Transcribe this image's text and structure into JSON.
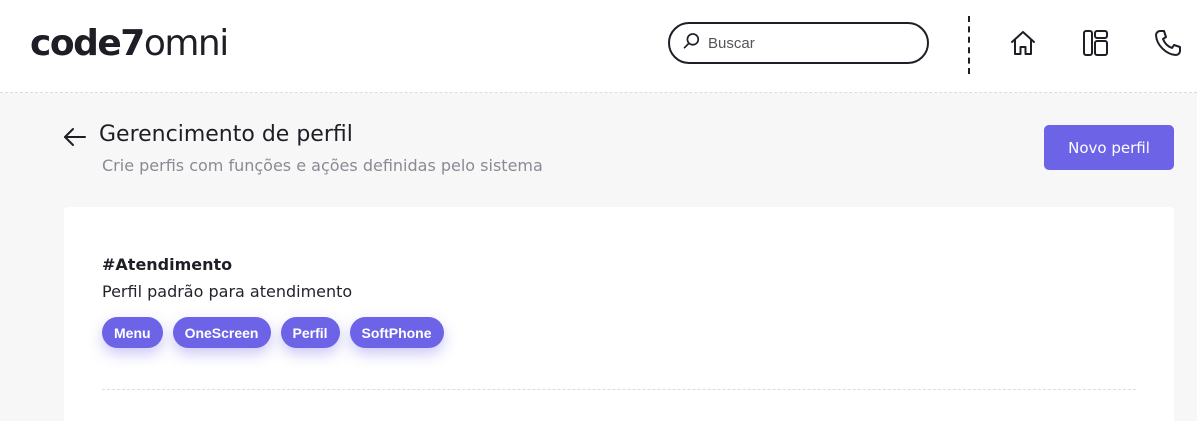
{
  "header": {
    "logo_bold": "code7",
    "logo_light": "omni",
    "search_placeholder": "Buscar"
  },
  "page": {
    "title": "Gerencimento de perfil",
    "subtitle": "Crie perfis com funções e ações definidas pelo sistema",
    "new_button_label": "Novo perfil"
  },
  "profiles": [
    {
      "name": "#Atendimento",
      "description": "Perfil padrão para atendimento",
      "tags": [
        "Menu",
        "OneScreen",
        "Perfil",
        "SoftPhone"
      ]
    }
  ],
  "colors": {
    "accent": "#6c63e6",
    "text": "#1e1e26",
    "muted": "#8a8a96",
    "background": "#f7f7f8"
  },
  "icons": [
    "search-icon",
    "home-icon",
    "layout-icon",
    "phone-icon",
    "back-arrow-icon"
  ]
}
